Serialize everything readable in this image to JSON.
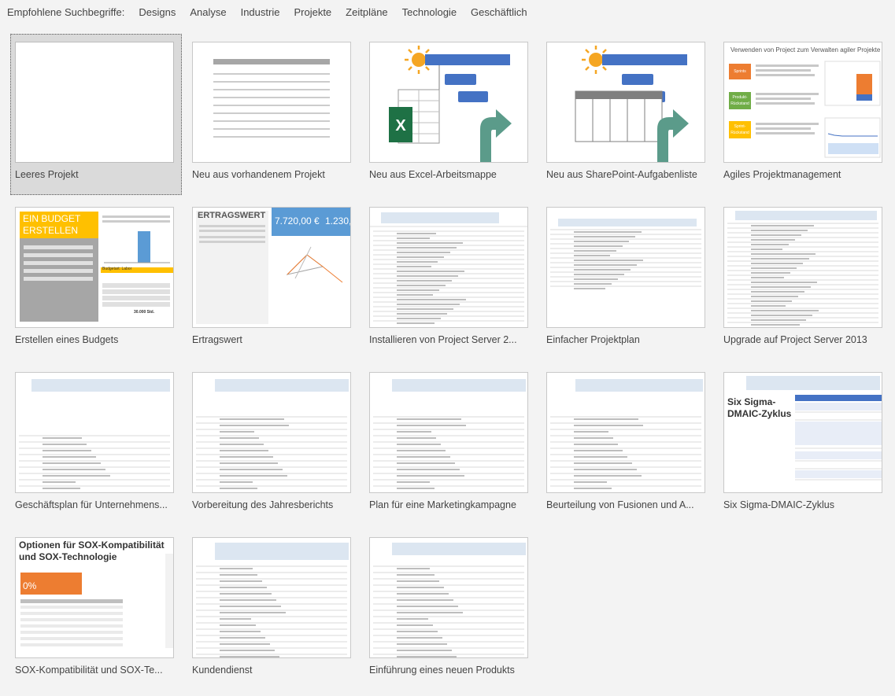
{
  "topbar": {
    "label": "Empfohlene Suchbegriffe:",
    "links": [
      "Designs",
      "Analyse",
      "Industrie",
      "Projekte",
      "Zeitpläne",
      "Technologie",
      "Geschäftlich"
    ]
  },
  "templates": [
    {
      "caption": "Leeres Projekt"
    },
    {
      "caption": "Neu aus vorhandenem Projekt"
    },
    {
      "caption": "Neu aus Excel-Arbeitsmappe"
    },
    {
      "caption": "Neu aus SharePoint-Aufgabenliste"
    },
    {
      "caption": "Agiles Projektmanagement",
      "thumb_title": "Verwenden von Project zum Verwalten agiler Projekte",
      "items": [
        "Sprints",
        "Produkt-Rückstand",
        "Sprint-Rückstand"
      ]
    },
    {
      "caption": "Erstellen eines Budgets",
      "thumb_title": "EIN BUDGET ERSTELLEN",
      "table_header": "Budgetart: Labor",
      "table_value": "30.000 Std."
    },
    {
      "caption": "Ertragswert",
      "thumb_title": "ERTRAGSWERT",
      "value1": "7.720,00 €",
      "value2": "1.230,"
    },
    {
      "caption": "Installieren von Project Server 2..."
    },
    {
      "caption": "Einfacher Projektplan"
    },
    {
      "caption": "Upgrade auf Project Server 2013"
    },
    {
      "caption": "Geschäftsplan für Unternehmens..."
    },
    {
      "caption": "Vorbereitung des Jahresberichts"
    },
    {
      "caption": "Plan für eine Marketingkampagne"
    },
    {
      "caption": "Beurteilung von Fusionen und A..."
    },
    {
      "caption": "Six Sigma-DMAIC-Zyklus",
      "thumb_title": "Six Sigma-DMAIC-Zyklus"
    },
    {
      "caption": "SOX-Kompatibilität und SOX-Te...",
      "thumb_title": "Optionen für SOX-Kompatibilität und SOX-Technologie",
      "percent": "0%"
    },
    {
      "caption": "Kundendienst"
    },
    {
      "caption": "Einführung eines neuen Produkts"
    }
  ],
  "colors": {
    "excel_green": "#1e7145",
    "project_blue": "#4472c4",
    "arrow_teal": "#5b9b8a",
    "sun_orange": "#f5a623",
    "budget_yellow": "#ffc000",
    "sox_orange": "#ed7d31"
  }
}
